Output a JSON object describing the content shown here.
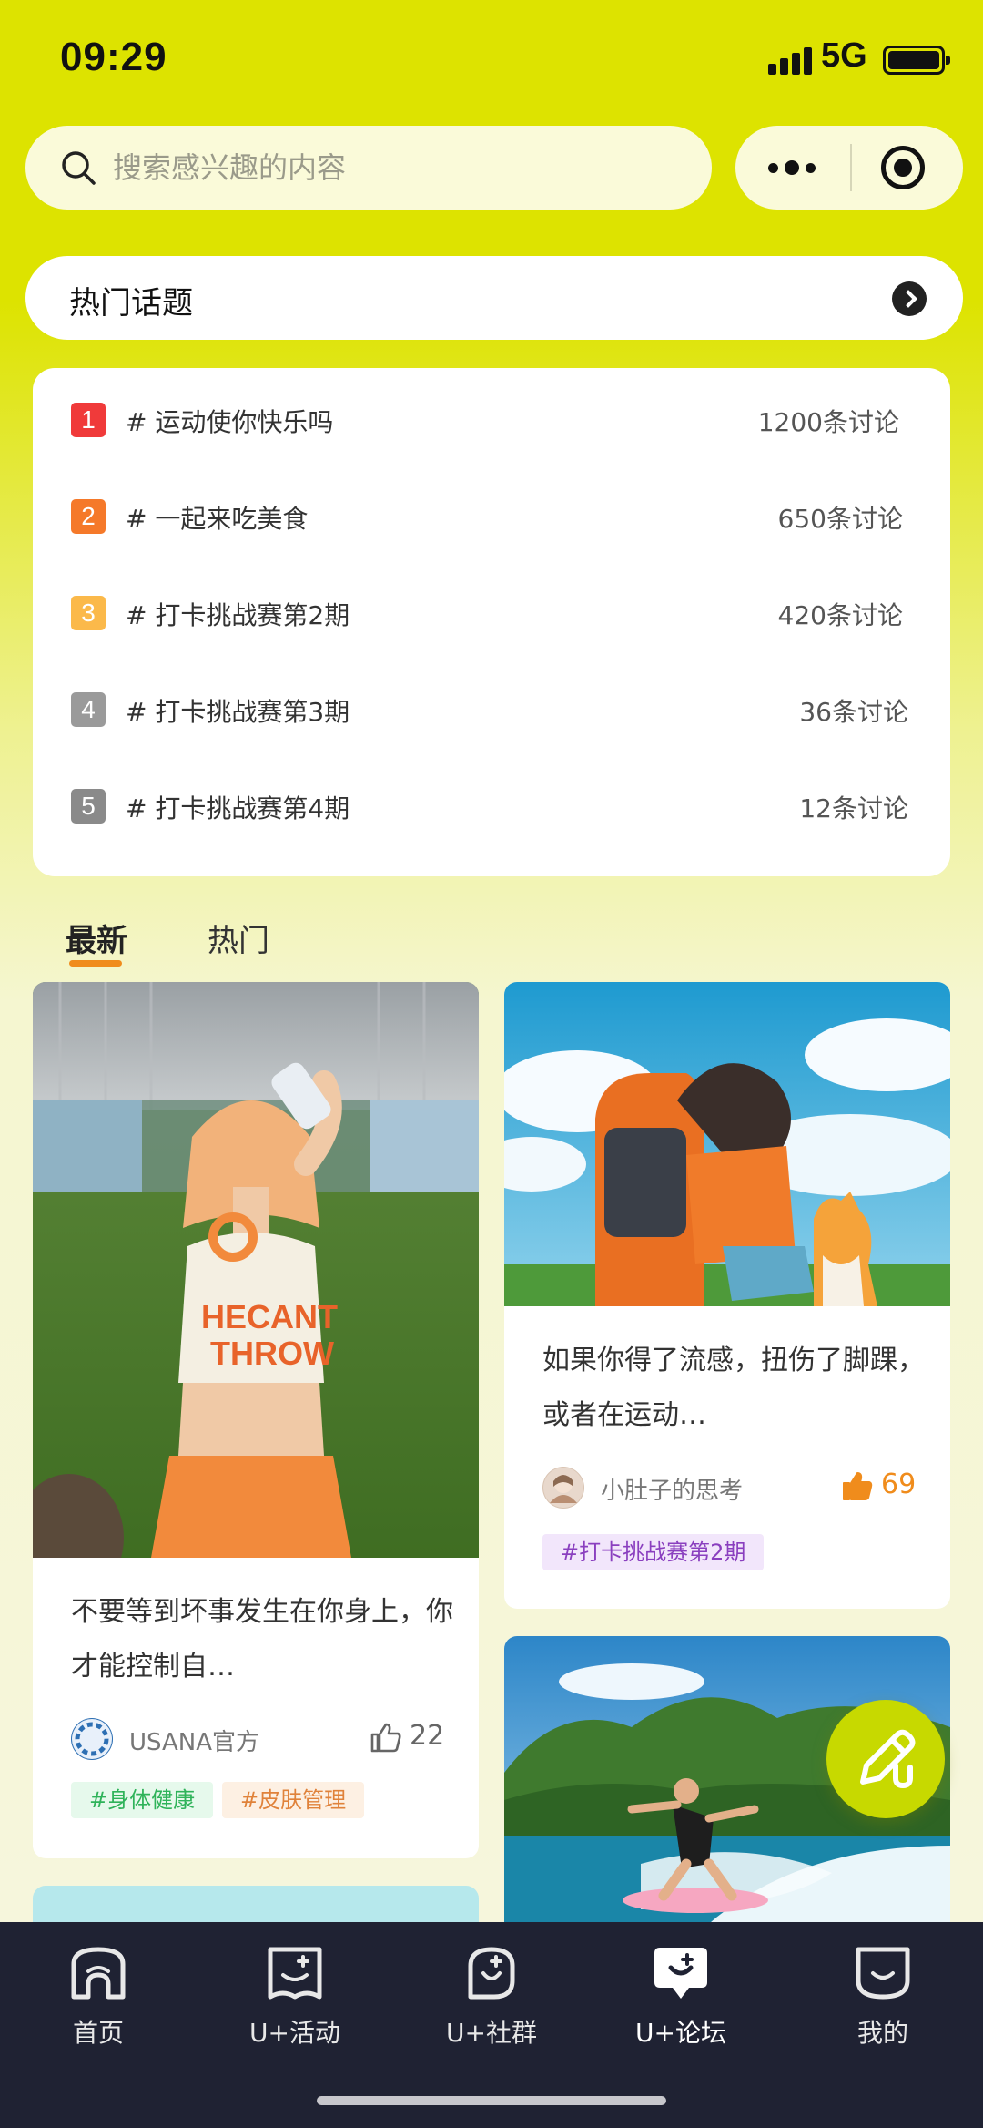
{
  "status_bar": {
    "time": "09:29",
    "network": "5G"
  },
  "search": {
    "placeholder": "搜索感兴趣的内容"
  },
  "hot_topics": {
    "title": "热门话题",
    "items": [
      {
        "rank": "1",
        "name": "# 运动使你快乐吗",
        "count": "1200条讨论",
        "color": "#f03a3a"
      },
      {
        "rank": "2",
        "name": "# 一起来吃美食",
        "count": "650条讨论",
        "color": "#f5792a"
      },
      {
        "rank": "3",
        "name": "# 打卡挑战赛第2期",
        "count": "420条讨论",
        "color": "#fbb94a"
      },
      {
        "rank": "4",
        "name": "# 打卡挑战赛第3期",
        "count": "36条讨论",
        "color": "#9a9a9a"
      },
      {
        "rank": "5",
        "name": "# 打卡挑战赛第4期",
        "count": "12条讨论",
        "color": "#8a8a8a"
      }
    ]
  },
  "feed_tabs": {
    "latest": "最新",
    "hot": "热门"
  },
  "posts": [
    {
      "text": "不要等到坏事发生在你身上，你才能控制自…",
      "author": "USANA官方",
      "likes": "22",
      "tags": [
        "#身体健康",
        "#皮肤管理"
      ],
      "tag_colors": [
        "#e6f9ec",
        "#fdf0e3"
      ],
      "tag_text_colors": [
        "#2fb35a",
        "#e0823a"
      ]
    },
    {
      "text": "如果你得了流感，扭伤了脚踝，或者在运动…",
      "author": "小肚子的思考",
      "likes": "69",
      "tags": [
        "#打卡挑战赛第2期"
      ],
      "tag_colors": [
        "#f2e6fb"
      ],
      "tag_text_colors": [
        "#8a3fbf"
      ]
    }
  ],
  "tabbar": [
    {
      "label": "首页",
      "icon": "home-icon"
    },
    {
      "label": "U+活动",
      "icon": "activity-icon"
    },
    {
      "label": "U+社群",
      "icon": "community-icon"
    },
    {
      "label": "U+论坛",
      "icon": "forum-icon",
      "active": true
    },
    {
      "label": "我的",
      "icon": "profile-icon"
    }
  ],
  "colors": {
    "accent": "#dde300",
    "like_active": "#f08c1c",
    "tabbar_bg": "#1f2233"
  }
}
